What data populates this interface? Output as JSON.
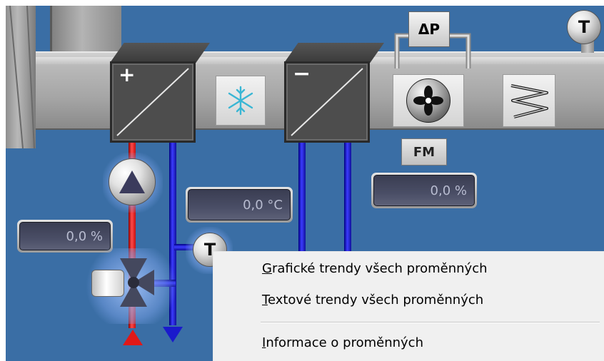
{
  "colors": {
    "background": "#3a6ea5",
    "hot_water": "#e01818",
    "cold_water": "#1a1acc",
    "menu_background": "#f0f0f0"
  },
  "pressure_sensor": {
    "label": "ΔP",
    "icon": "differential-pressure-icon"
  },
  "temp_sensor_top": {
    "label": "T",
    "icon": "temperature-sensor-icon"
  },
  "heater": {
    "sign": "+",
    "icon": "heat-exchanger-icon"
  },
  "cooler": {
    "sign": "−",
    "icon": "heat-exchanger-icon"
  },
  "frost": {
    "icon": "snowflake-icon"
  },
  "fan": {
    "icon": "fan-icon",
    "fault_label": "FM",
    "value": "0,0 %"
  },
  "filter": {
    "icon": "filter-icon"
  },
  "heating_loop": {
    "pump_icon": "pump-icon",
    "valve_icon": "three-way-valve-icon",
    "valve_value": "0,0 %",
    "water_temp": "0,0 °C",
    "temp_sensor_label": "T"
  },
  "context_menu": {
    "items": [
      {
        "accel": "G",
        "rest": "rafické trendy všech proměnných"
      },
      {
        "accel": "T",
        "rest": "extové trendy všech proměnných"
      },
      {
        "accel": "I",
        "rest": "nformace o proměnných"
      }
    ]
  }
}
